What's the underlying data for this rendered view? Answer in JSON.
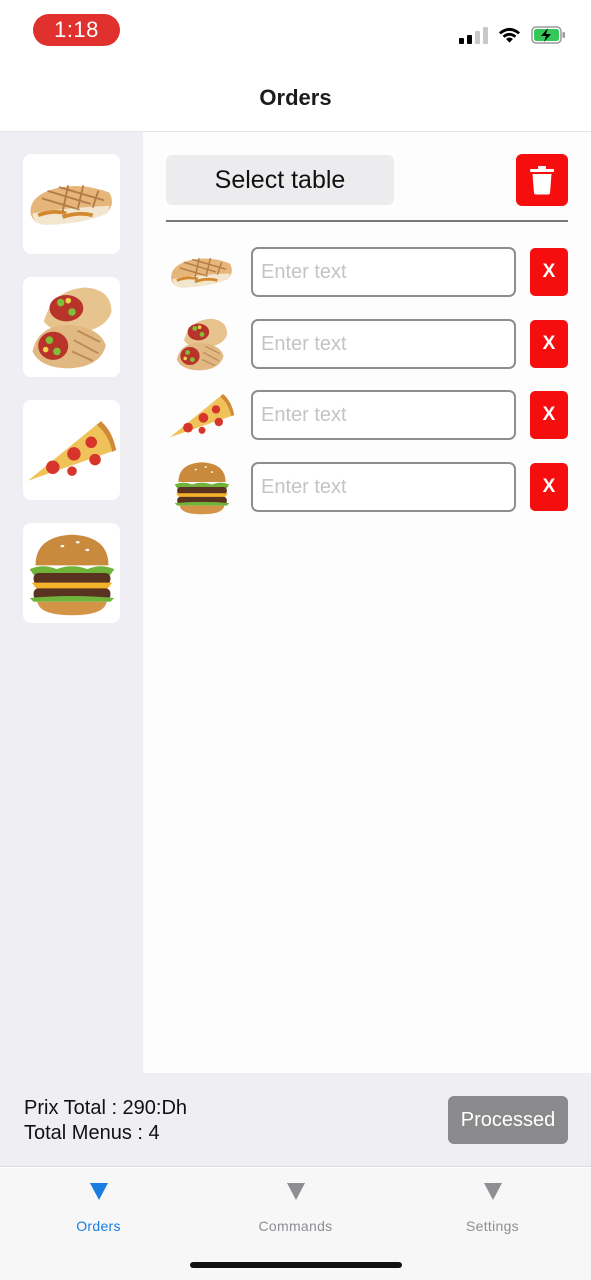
{
  "status_bar": {
    "time": "1:18",
    "icons": [
      "cellular-signal-icon",
      "wifi-icon",
      "battery-charging-icon"
    ],
    "time_pill_color": "#e0312f"
  },
  "header": {
    "title": "Orders"
  },
  "menu": {
    "items": [
      {
        "name": "panini",
        "icon": "panini-image"
      },
      {
        "name": "wrap",
        "icon": "wrap-image"
      },
      {
        "name": "pizza slice",
        "icon": "pizza-slice-image"
      },
      {
        "name": "burger",
        "icon": "burger-image"
      }
    ]
  },
  "order": {
    "select_table_label": "Select table",
    "delete_icon": "trash-icon",
    "items": [
      {
        "icon": "panini-image",
        "placeholder": "Enter text",
        "remove_label": "X"
      },
      {
        "icon": "wrap-image",
        "placeholder": "Enter text",
        "remove_label": "X"
      },
      {
        "icon": "pizza-slice-image",
        "placeholder": "Enter text",
        "remove_label": "X"
      },
      {
        "icon": "burger-image",
        "placeholder": "Enter text",
        "remove_label": "X"
      }
    ],
    "accent_red": "#f60d0d"
  },
  "summary": {
    "total_price": "Prix Total : 290:Dh",
    "total_menus": "Total Menus : 4",
    "processed_label": "Processed"
  },
  "tabs": [
    {
      "label": "Orders",
      "icon": "triangle-down-icon",
      "active": true
    },
    {
      "label": "Commands",
      "icon": "triangle-down-icon",
      "active": false
    },
    {
      "label": "Settings",
      "icon": "triangle-down-icon",
      "active": false
    }
  ],
  "colors": {
    "active_tab": "#1a7de0",
    "inactive_tab": "#8e8e93",
    "button_gray": "#8a8a8c"
  }
}
